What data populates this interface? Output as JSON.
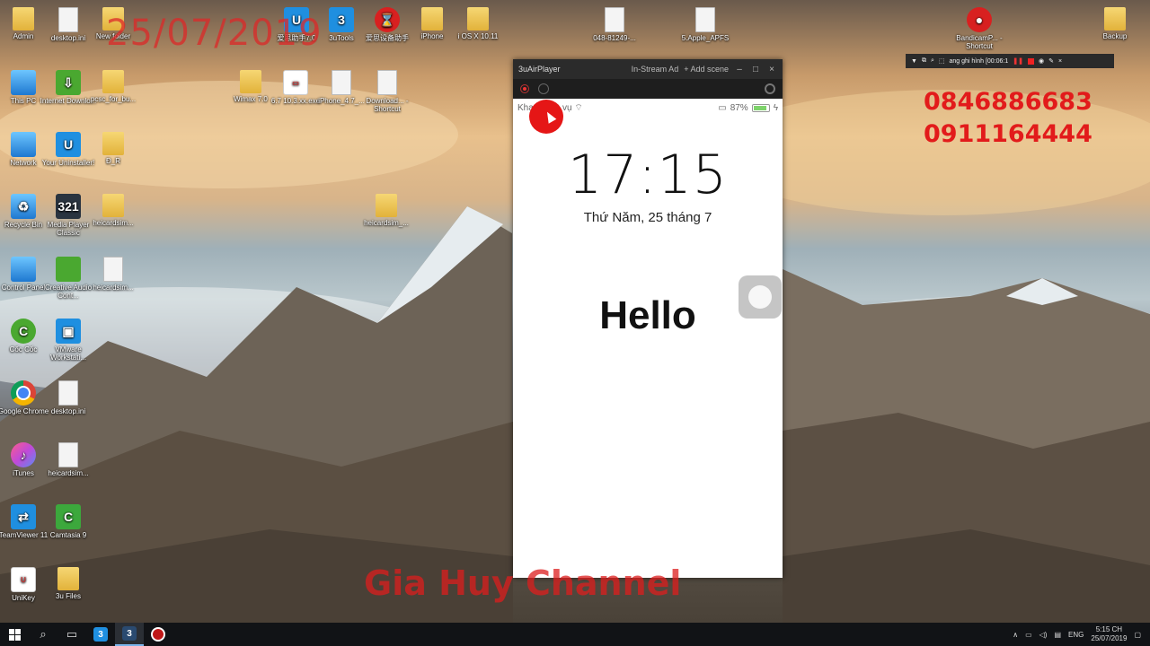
{
  "watermark": {
    "date": "25/07/2019",
    "phone1": "0846886683",
    "phone2": "0911164444",
    "channel": "Gia Huy Channel"
  },
  "desktop_icons": [
    {
      "label": "Admin",
      "kind": "folder"
    },
    {
      "label": "desktop.ini",
      "kind": "file"
    },
    {
      "label": "New folder",
      "kind": "folder"
    },
    {
      "label": "爱思助手7.0",
      "kind": "blue"
    },
    {
      "label": "3uTools",
      "kind": "blue"
    },
    {
      "label": "爱思设备助手",
      "kind": "red"
    },
    {
      "label": "iPhone",
      "kind": "folder"
    },
    {
      "label": "i OS X 10.11",
      "kind": "folder"
    },
    {
      "label": "048-81249-...",
      "kind": "file"
    },
    {
      "label": "5.Apple_APFS",
      "kind": "file"
    },
    {
      "label": "BandicamP... - Shortcut",
      "kind": "red"
    },
    {
      "label": "Backup",
      "kind": "folder"
    },
    {
      "label": "This PC",
      "kind": "pc"
    },
    {
      "label": "Internet Downlo...",
      "kind": "green"
    },
    {
      "label": "pcsc_for_bu...",
      "kind": "folder"
    },
    {
      "label": "Wimax 7.0",
      "kind": "folder"
    },
    {
      "label": "6.7 10.3.xx.exe",
      "kind": "white"
    },
    {
      "label": "iPhone_4.7_...",
      "kind": "file"
    },
    {
      "label": "Download... - Shortcut",
      "kind": "file"
    },
    {
      "label": "Network",
      "kind": "pc"
    },
    {
      "label": "Your Uninstaller!",
      "kind": "blue"
    },
    {
      "label": "Đ_R",
      "kind": "folder"
    },
    {
      "label": "Recycle Bin",
      "kind": "pc"
    },
    {
      "label": "Media Player Classic",
      "kind": "dark"
    },
    {
      "label": "heicardsim...",
      "kind": "folder"
    },
    {
      "label": "heicardsim_...",
      "kind": "folder"
    },
    {
      "label": "Control Panel",
      "kind": "pc"
    },
    {
      "label": "Creative Audio Cont...",
      "kind": "green"
    },
    {
      "label": "heicardsim...",
      "kind": "file"
    },
    {
      "label": "Cốc Cốc",
      "kind": "green"
    },
    {
      "label": "VMware Workstati...",
      "kind": "blue"
    },
    {
      "label": "Google Chrome",
      "kind": "chrome"
    },
    {
      "label": "desktop.ini",
      "kind": "file"
    },
    {
      "label": "iTunes",
      "kind": "itunes"
    },
    {
      "label": "heicardsim...",
      "kind": "file"
    },
    {
      "label": "TeamViewer 11",
      "kind": "blue"
    },
    {
      "label": "Camtasia 9",
      "kind": "lime"
    },
    {
      "label": "UniKey",
      "kind": "white"
    },
    {
      "label": "3u Files",
      "kind": "folder"
    }
  ],
  "airplayer": {
    "title": "3uAirPlayer",
    "instream": "In-Stream Ad",
    "add_scene": "+ Add scene",
    "min": "–",
    "max": "□",
    "close": "×"
  },
  "phone": {
    "carrier": "Khang ...D.vụ",
    "battery": "87%",
    "battery_level": 0.87,
    "time": "17:15",
    "date": "Thứ Năm, 25 tháng 7",
    "message": "Hello"
  },
  "bandicam": {
    "status": "ang ghi hình [00:06:1"
  },
  "taskbar": {
    "lang": "ENG",
    "time": "5:15 CH",
    "date": "25/07/2019"
  }
}
